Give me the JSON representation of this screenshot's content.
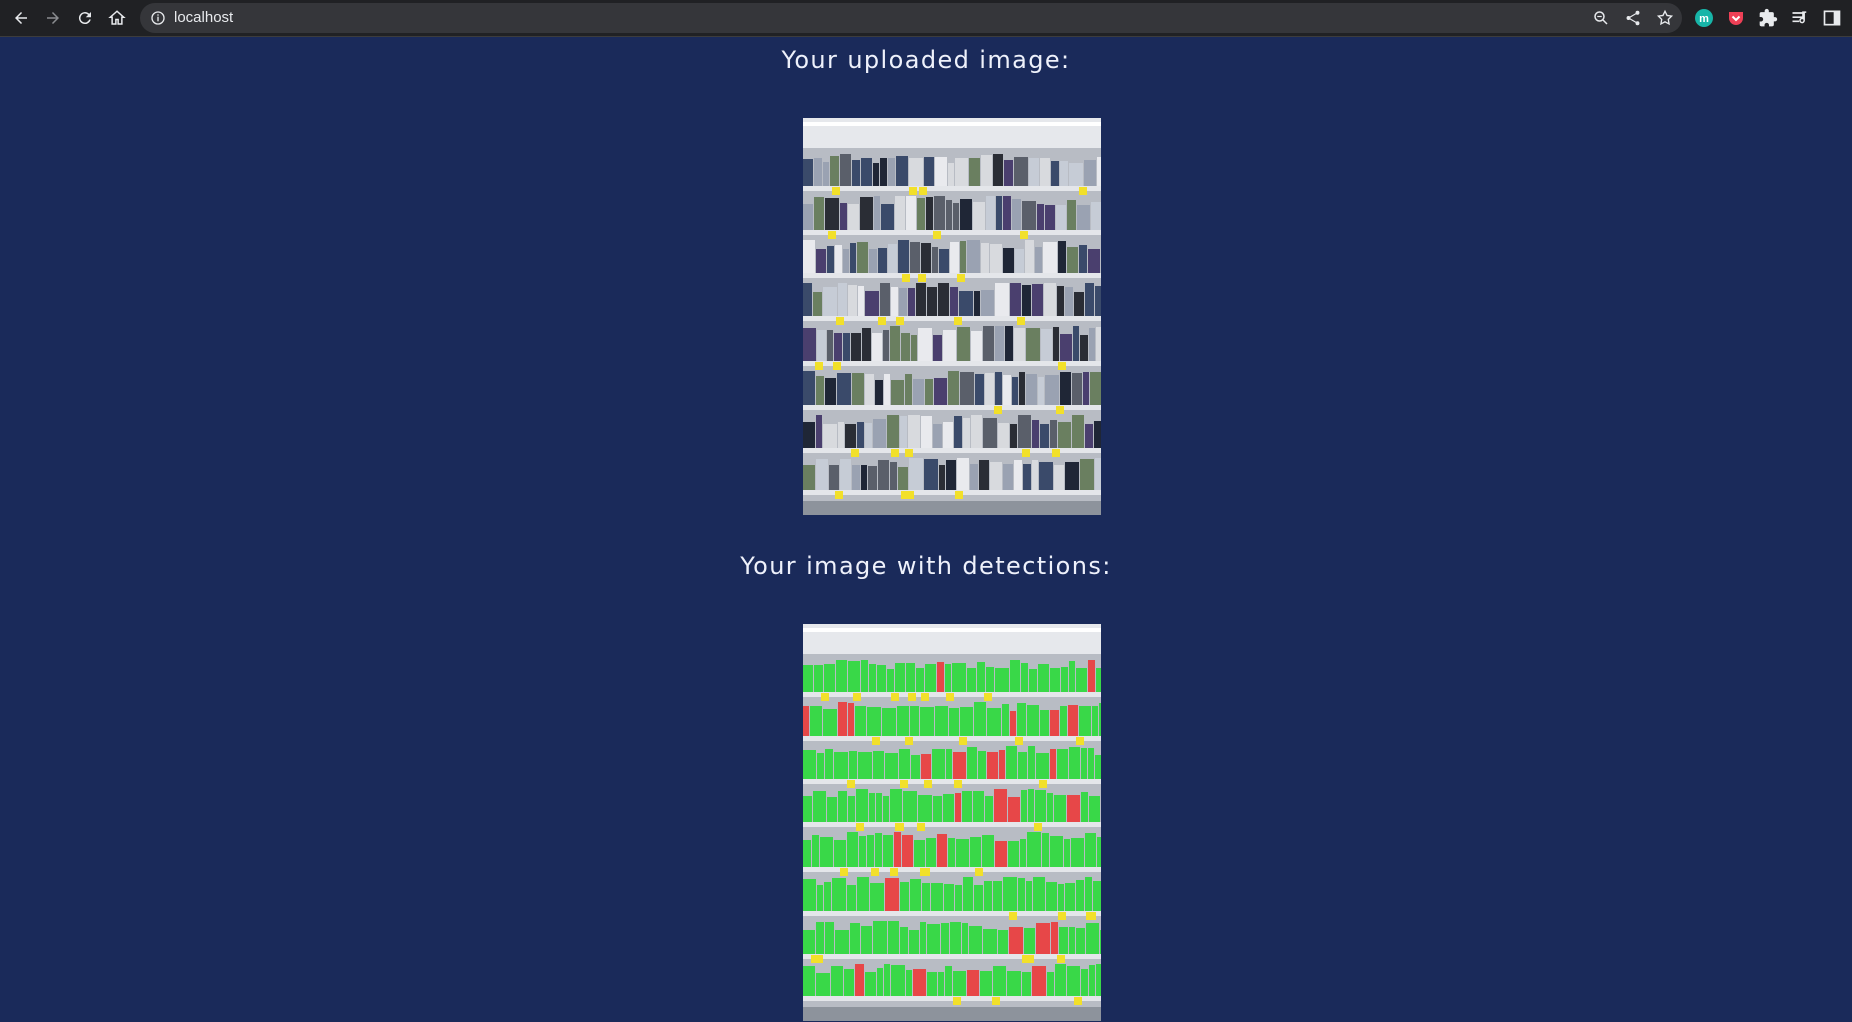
{
  "browser": {
    "url": "localhost",
    "icons": {
      "back": "arrow-left-icon",
      "forward": "arrow-right-icon",
      "reload": "reload-icon",
      "home": "home-icon",
      "site_info": "info-icon",
      "zoom": "zoom-icon",
      "share": "share-icon",
      "bookmark": "star-icon",
      "extension_m": "m-extension-icon",
      "pocket": "pocket-icon",
      "extensions": "puzzle-icon",
      "reading_list": "reading-list-icon",
      "side_panel": "side-panel-icon"
    },
    "extension_m_letter": "m"
  },
  "page": {
    "uploaded_heading": "Your uploaded image:",
    "detections_heading": "Your image with detections:",
    "colors": {
      "background": "#1a2a5a",
      "heading": "#eef1fb",
      "detection_ok": "#22dd33",
      "detection_flag": "#ee3333"
    }
  }
}
